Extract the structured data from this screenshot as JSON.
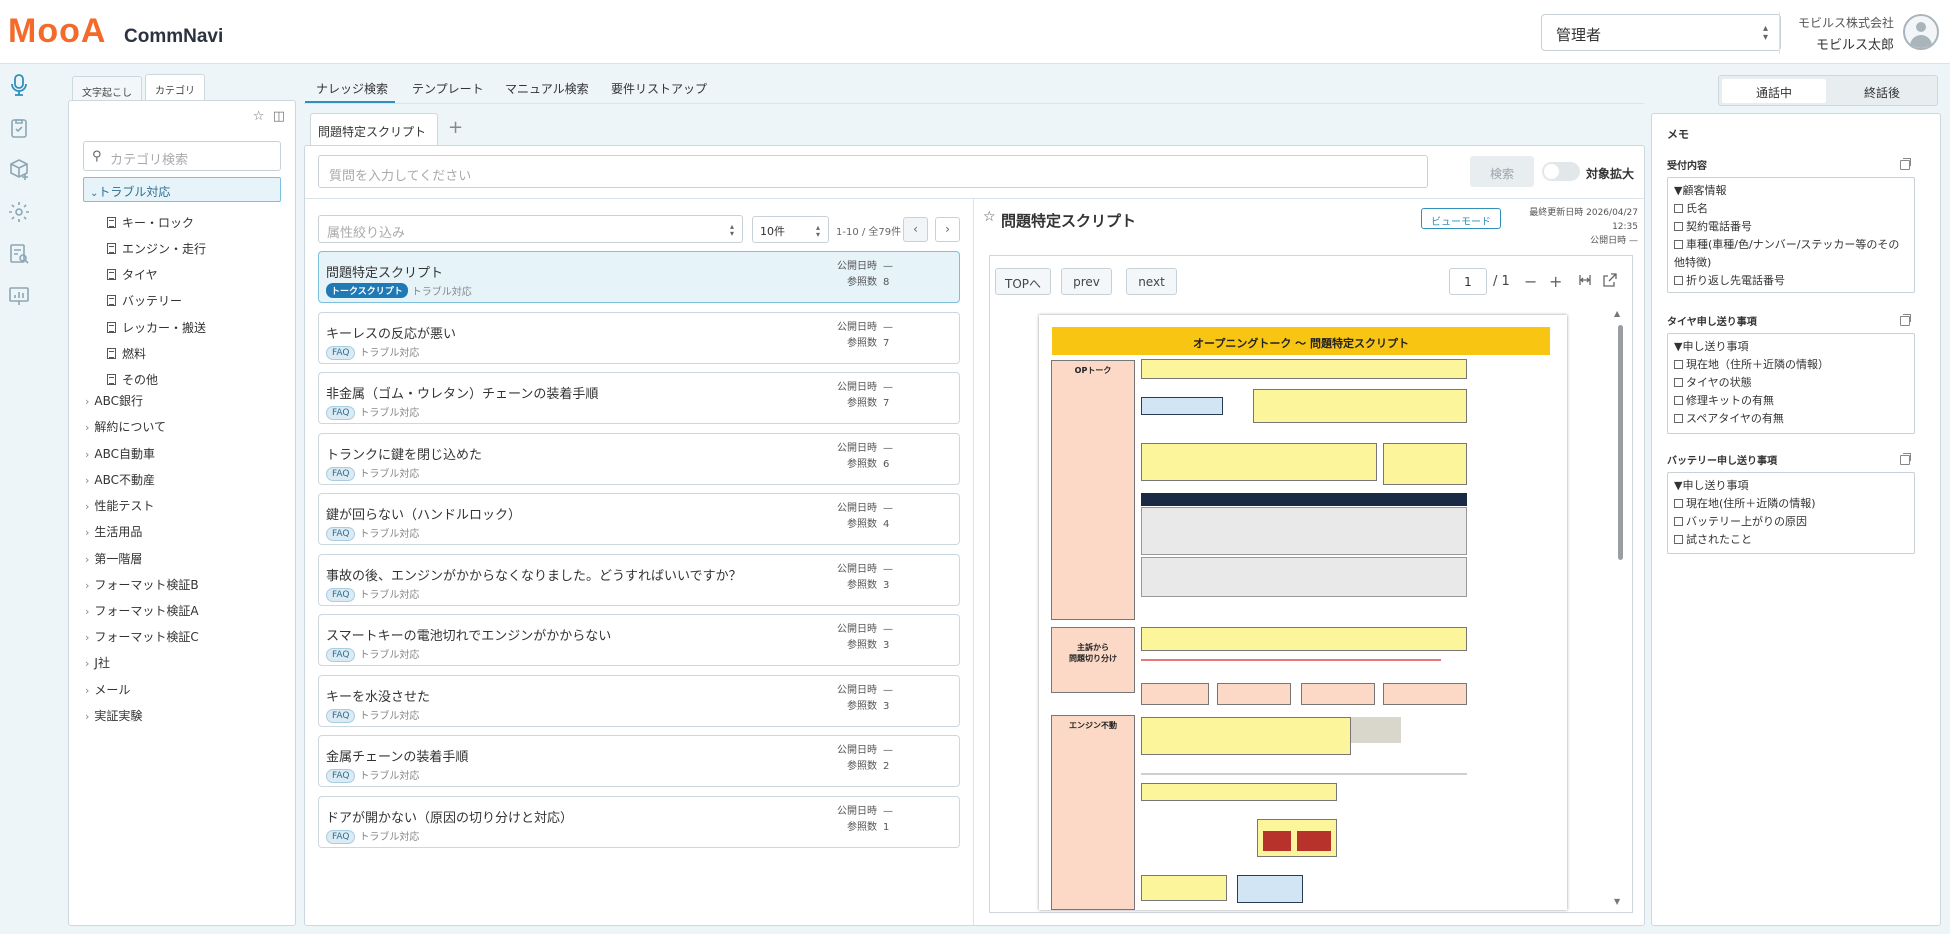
{
  "header": {
    "logo": "MooA",
    "app_name": "CommNavi",
    "role": "管理者",
    "company": "モビルス株式会社",
    "user": "モビルス太郎"
  },
  "category_panel": {
    "tabs": [
      "文字起こし",
      "カテゴリ"
    ],
    "search_placeholder": "カテゴリ検索",
    "selected": "トラブル対応",
    "children": [
      "キー・ロック",
      "エンジン・走行",
      "タイヤ",
      "バッテリー",
      "レッカー・搬送",
      "燃料",
      "その他"
    ],
    "others": [
      "ABC銀行",
      "解約について",
      "ABC自動車",
      "ABC不動産",
      "性能テスト",
      "生活用品",
      "第一階層",
      "フォーマット検証B",
      "フォーマット検証A",
      "フォーマット検証C",
      "J社",
      "メール",
      "実証実験"
    ]
  },
  "main_tabs": [
    "ナレッジ検索",
    "テンプレート",
    "マニュアル検索",
    "要件リストアップ"
  ],
  "sub_tab": "問題特定スクリプト",
  "search": {
    "placeholder": "質問を入力してください",
    "button": "検索",
    "toggle_label": "対象拡大"
  },
  "results": {
    "filter_placeholder": "属性絞り込み",
    "count": "10件",
    "pager": "1-10 / 全79件",
    "meta_published_label": "公開日時",
    "meta_views_label": "参照数",
    "items": [
      {
        "title": "問題特定スクリプト",
        "badge": "トークスクリプト",
        "category": "トラブル対応",
        "published": "—",
        "views": "8"
      },
      {
        "title": "キーレスの反応が悪い",
        "badge": "FAQ",
        "category": "トラブル対応",
        "published": "—",
        "views": "7"
      },
      {
        "title": "非金属（ゴム・ウレタン）チェーンの装着手順",
        "badge": "FAQ",
        "category": "トラブル対応",
        "published": "—",
        "views": "7"
      },
      {
        "title": "トランクに鍵を閉じ込めた",
        "badge": "FAQ",
        "category": "トラブル対応",
        "published": "—",
        "views": "6"
      },
      {
        "title": "鍵が回らない（ハンドルロック）",
        "badge": "FAQ",
        "category": "トラブル対応",
        "published": "—",
        "views": "4"
      },
      {
        "title": "事故の後、エンジンがかからなくなりました。どうすればいいですか？",
        "badge": "FAQ",
        "category": "トラブル対応",
        "published": "—",
        "views": "3"
      },
      {
        "title": "スマートキーの電池切れでエンジンがかからない",
        "badge": "FAQ",
        "category": "トラブル対応",
        "published": "—",
        "views": "3"
      },
      {
        "title": "キーを水没させた",
        "badge": "FAQ",
        "category": "トラブル対応",
        "published": "—",
        "views": "3"
      },
      {
        "title": "金属チェーンの装着手順",
        "badge": "FAQ",
        "category": "トラブル対応",
        "published": "—",
        "views": "2"
      },
      {
        "title": "ドアが開かない（原因の切り分けと対応）",
        "badge": "FAQ",
        "category": "トラブル対応",
        "published": "—",
        "views": "1"
      }
    ]
  },
  "document": {
    "title": "問題特定スクリプト",
    "view_mode": "ビューモード",
    "last_updated": "最終更新日時 2026/04/27 12:35",
    "published": "公開日時 —",
    "toolbar": {
      "top": "TOPへ",
      "prev": "prev",
      "next": "next",
      "page": "1",
      "total": "/ 1"
    },
    "page_title": "オープニングトーク ～ 問題特定スクリプト",
    "page_sections": [
      "OPトーク",
      "主訴から\n問題切り分け",
      "エンジン不動"
    ]
  },
  "right_panel": {
    "tabs": [
      "通話中",
      "終話後"
    ],
    "memo_title": "メモ",
    "sections": [
      {
        "title": "受付内容",
        "lines": [
          "▼顧客情報",
          "氏名",
          "契約電話番号",
          "車種(車種/色/ナンバー/ステッカー等のその他特徴)",
          "折り返し先電話番号"
        ]
      },
      {
        "title": "タイヤ申し送り事項",
        "lines": [
          "▼申し送り事項",
          "現在地（住所＋近隣の情報）",
          "タイヤの状態",
          "修理キットの有無",
          "スペアタイヤの有無"
        ]
      },
      {
        "title": "バッテリー申し送り事項",
        "lines": [
          "▼申し送り事項",
          "現在地(住所＋近隣の情報)",
          "バッテリー上がりの原因",
          "試されたこと"
        ]
      }
    ]
  },
  "colors": {
    "accent": "#2f8fbd",
    "logo": "#f36a2a",
    "selected_bg": "#e6f4fa"
  }
}
